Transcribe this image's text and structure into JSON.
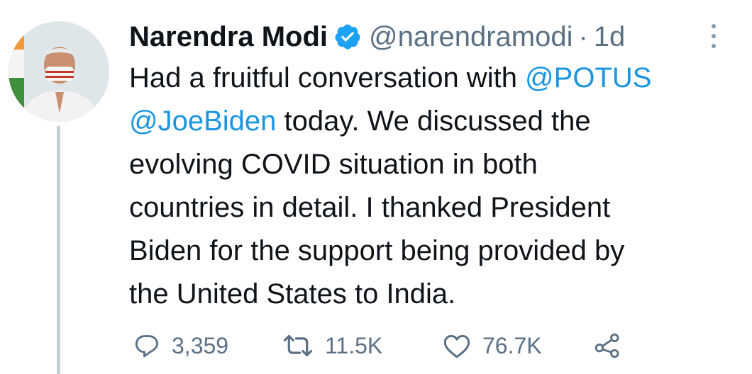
{
  "tweet": {
    "author": {
      "name": "Narendra Modi",
      "handle": "@narendramodi",
      "verified": true,
      "avatar_icon": "profile-photo"
    },
    "separator": "·",
    "time": "1d",
    "body": {
      "line1_text": "Had a fruitful conversation with ",
      "mention1": "@POTUS",
      "mention2": "@JoeBiden",
      "line2_text": " today. We discussed the",
      "line3": "evolving COVID situation in both",
      "line4": "countries in detail. I thanked President",
      "line5": "Biden for the support being provided by",
      "line6": "the United States to India."
    },
    "actions": {
      "reply": {
        "icon": "reply-icon",
        "count": "3,359"
      },
      "retweet": {
        "icon": "retweet-icon",
        "count": "11.5K"
      },
      "like": {
        "icon": "heart-icon",
        "count": "76.7K"
      },
      "share": {
        "icon": "share-icon"
      }
    }
  },
  "colors": {
    "text": "#0f1419",
    "secondary": "#5b7083",
    "link": "#1b95e0",
    "verified": "#1da1f2",
    "thread_line": "#c4cfd6"
  }
}
